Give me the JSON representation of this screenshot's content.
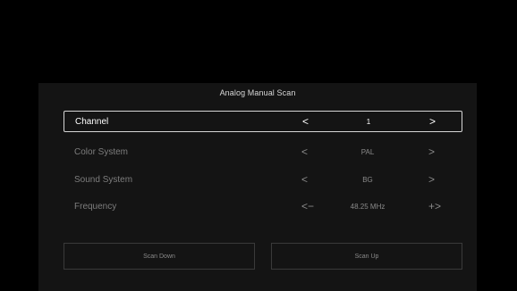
{
  "panel": {
    "title": "Analog Manual Scan"
  },
  "rows": [
    {
      "label": "Channel",
      "left_arrow": "<",
      "value": "1",
      "right_arrow": ">",
      "focused": true
    },
    {
      "label": "Color System",
      "left_arrow": "<",
      "value": "PAL",
      "right_arrow": ">",
      "focused": false
    },
    {
      "label": "Sound System",
      "left_arrow": "<",
      "value": "BG",
      "right_arrow": ">",
      "focused": false
    },
    {
      "label": "Frequency",
      "left_arrow": "<−",
      "value": "48.25 MHz",
      "right_arrow": "+>",
      "focused": false
    }
  ],
  "buttons": {
    "scan_down": "Scan Down",
    "scan_up": "Scan Up"
  },
  "colors": {
    "background": "#000000",
    "panel": "#141414",
    "focused_text": "#ffffff",
    "dim_text": "#8a8a8a",
    "focus_border": "#d6d6d6"
  }
}
